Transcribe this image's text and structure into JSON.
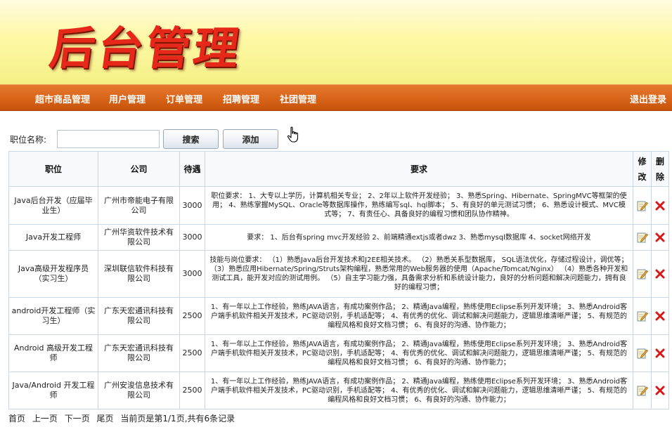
{
  "header": {
    "title": "后台管理"
  },
  "nav": {
    "items": [
      "超市商品管理",
      "用户管理",
      "订单管理",
      "招聘管理",
      "社团管理"
    ],
    "logout": "退出登录"
  },
  "search": {
    "label": "职位名称:",
    "value": "",
    "search_button": "搜索",
    "add_button": "添加"
  },
  "table": {
    "columns": {
      "position": "职位",
      "company": "公司",
      "salary": "待遇",
      "requirements": "要求",
      "edit": [
        "修",
        "改"
      ],
      "delete": [
        "删",
        "除"
      ]
    },
    "rows": [
      {
        "position": "Java后台开发（应届毕业生）",
        "company": "广州市帝能电子有限公司",
        "salary": "3000",
        "requirements": "职位要求： 1、大专以上学历，计算机相关专业； 2、2年以上软件开发经验； 3、熟悉Spring、Hibernate、SpringMVC等框架的使用； 4、熟练掌握MySQL、Oracle等数据库操作，熟练编写sql、hql脚本； 5、有良好的单元测试习惯； 6、熟悉设计模式、MVC模式等； 7、有责任心、具备良好的编程习惯和团队协作精神。"
      },
      {
        "position": "Java开发工程师",
        "company": "广州华资软件技术有限公司",
        "salary": "3000",
        "requirements": "要求： 1、后台有spring mvc开发经验 2、前端精通extjs或者dwz 3、熟悉mysql数据库 4、socket网络开发"
      },
      {
        "position": "Java高级开发程序员（实习生）",
        "company": "深圳联信软件科技有限公司",
        "salary": "3000",
        "requirements": "技能与岗位要求： （1）熟悉Java后台开发技术和J2EE相关技术。 （2）熟悉关系型数据库， SQL语法优化，存储过程设计，调优等； （3）熟悉应用Hibernate/Spring/Struts架构编程，熟悉常用的Web服务器的使用（Apache/Tomcat/Nginx） （4）熟悉各种开发和测试工具，能开发对应的测试用例。 （5）自主学习能力强，具备需求分析和系统设计能力，良好的分析问题和解决问题能力，拥有良好的编程习惯；"
      },
      {
        "position": "android开发工程师（实习生）",
        "company": "广东天宏通讯科技有限公司",
        "salary": "2500",
        "requirements": "1、有一年以上工作经验，熟练JAVA语言，有成功案例作品； 2、精通Java编程，熟练使用Eclipse系列开发环境； 3、熟悉Android客户端手机软件相关开发技术，PC驱动识别，手机适配等； 4、有优秀的优化、调试和解决问题能力，逻辑思维清晰严谨； 5、有规范的编程风格和良好文档习惯； 6、有良好的沟通、协作能力；"
      },
      {
        "position": "Android 高级开发工程师",
        "company": "广东天宏通讯科技有限公司",
        "salary": "2500",
        "requirements": "1、有一年以上工作经验，熟练JAVA语言，有成功案例作品； 2、精通Java编程，熟练使用Eclipse系列开发环境； 3、熟悉Android客户端手机软件相关开发技术，PC驱动识别，手机适配等； 4、有优秀的优化、调试和解决问题能力，逻辑思维清晰严谨； 5、有规范的编程风格和良好文档习惯； 6、有良好的沟通、协作能力；"
      },
      {
        "position": "Java/Android 开发工程师",
        "company": "广州安浚信息技术有限公司",
        "salary": "2500",
        "requirements": "1、有一年以上工作经验，熟练JAVA语言，有成功案例作品； 2、精通Java编程，熟练使用Eclipse系列开发环境； 3、熟悉Android客户端手机软件相关开发技术，PC驱动识别，手机适配等； 4、有优秀的优化、调试和解决问题能力，逻辑思维清晰严谨； 5、有规范的编程风格和良好文档习惯； 6、有良好的沟通、协作能力；"
      }
    ]
  },
  "pager": {
    "first": "首页",
    "prev": "上一页",
    "next": "下一页",
    "last": "尾页",
    "status": "当前页是第1/1页,共有6条记录"
  },
  "colors": {
    "nav_bg": "#d86418",
    "banner_bg": "#fdf8a4",
    "title_red": "#e6281a",
    "table_border": "#c9d6e4"
  },
  "icons": {
    "edit": "edit-pencil-icon",
    "delete": "delete-x-icon",
    "cursor": "hand-pointer-icon"
  }
}
